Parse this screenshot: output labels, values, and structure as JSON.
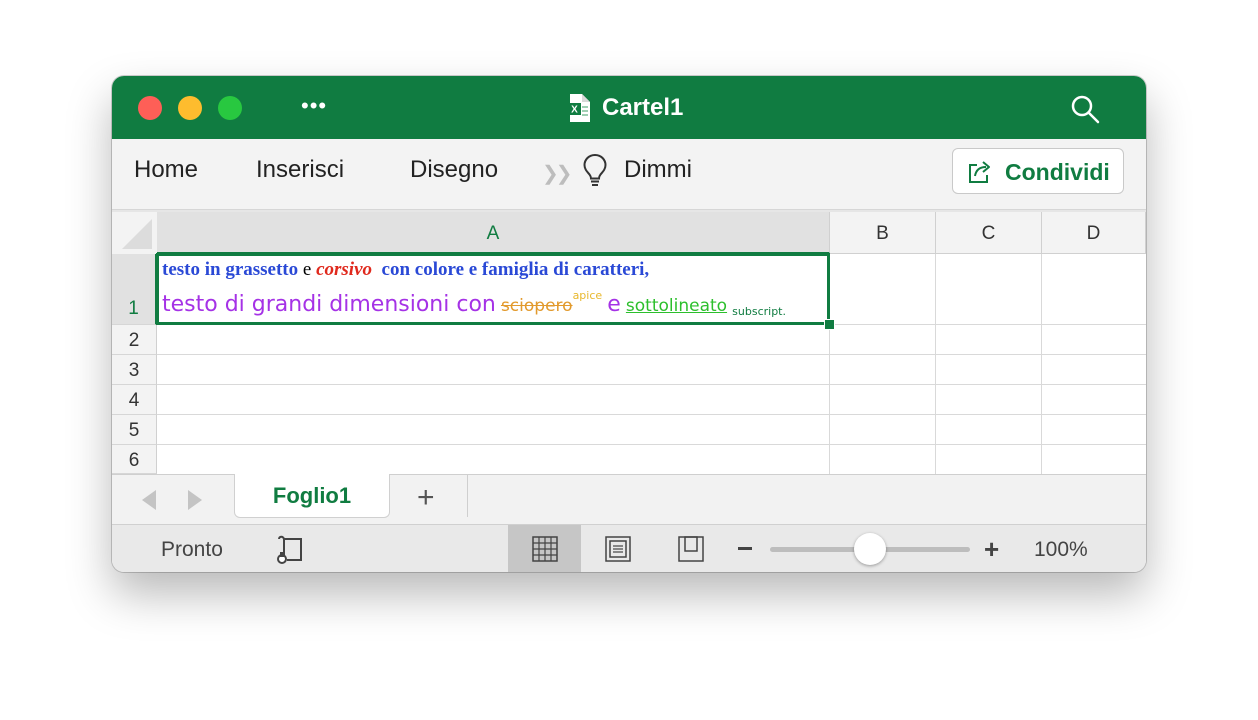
{
  "window": {
    "title": "Cartel1"
  },
  "ribbon": {
    "tabs": [
      "Home",
      "Inserisci",
      "Disegno",
      "Dimmi"
    ],
    "share_label": "Condividi"
  },
  "grid": {
    "columns": [
      "A",
      "B",
      "C",
      "D"
    ],
    "rows": [
      "1",
      "2",
      "3",
      "4",
      "5",
      "6"
    ],
    "selected_cell": "A1",
    "cell_a1": {
      "line1": {
        "bold": "testo in grassetto",
        "plain": "e",
        "italic": "corsivo",
        "rest": "con colore e famiglia di caratteri,"
      },
      "line2": {
        "large": "testo di grandi dimensioni con",
        "strike": "sciopero",
        "superscript": "apice",
        "conj": "e",
        "underline": "sottolineato",
        "subscript": "subscript."
      }
    }
  },
  "sheets": {
    "tabs": [
      "Foglio1"
    ],
    "active": "Foglio1"
  },
  "status": {
    "text": "Pronto",
    "zoom": "100%",
    "zoom_level": 0.5
  },
  "colors": {
    "accent": "#107c41",
    "blue": "#2a49d6",
    "red": "#e0291d",
    "purple": "#a532e6",
    "orange": "#e29a2d",
    "yellow": "#e8b82d",
    "green": "#2cbf2c"
  },
  "icons": [
    "more-icon",
    "excel-file-icon",
    "search-icon",
    "chevrons-icon",
    "lightbulb-icon",
    "share-icon",
    "prev-sheet-icon",
    "next-sheet-icon",
    "add-sheet-icon",
    "macro-icon",
    "normal-view-icon",
    "page-layout-icon",
    "page-break-icon"
  ]
}
